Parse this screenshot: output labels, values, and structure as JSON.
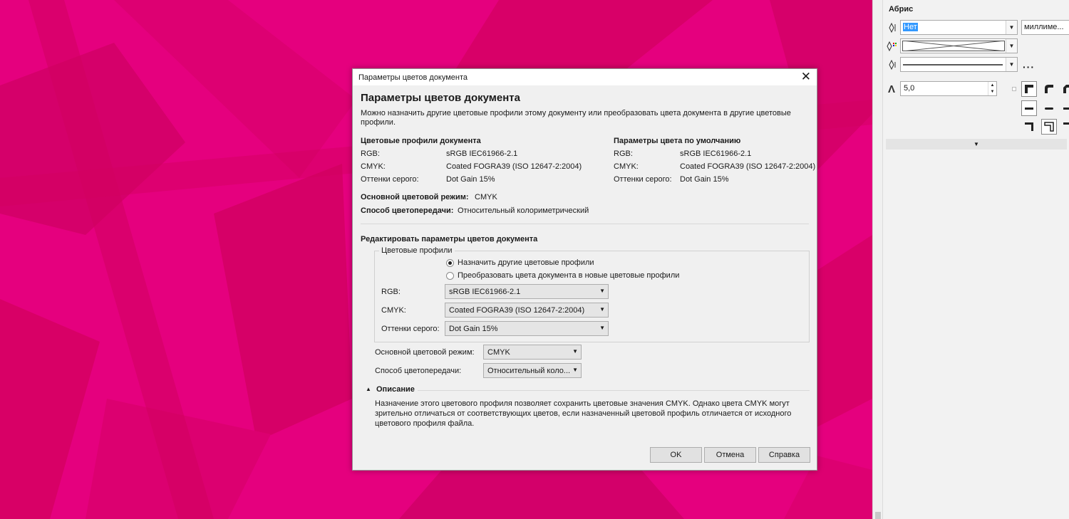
{
  "docker": {
    "title": "Абрис",
    "outline_width_value": "Нет",
    "units_value": "миллиме...",
    "miter_limit_value": "5,0",
    "expand_icon": "chevron-down-icon"
  },
  "dialog": {
    "window_title": "Параметры цветов документа",
    "heading": "Параметры цветов документа",
    "intro": "Можно назначить другие цветовые профили этому документу или преобразовать цвета документа в другие цветовые",
    "intro_cont": "профили.",
    "doc_profiles": {
      "heading": "Цветовые профили документа",
      "rgb_label": "RGB:",
      "rgb_value": "sRGB IEC61966-2.1",
      "cmyk_label": "CMYK:",
      "cmyk_value": "Coated FOGRA39 (ISO 12647-2:2004)",
      "gray_label": "Оттенки серого:",
      "gray_value": "Dot Gain 15%"
    },
    "default_settings": {
      "heading": "Параметры цвета по умолчанию",
      "rgb_label": "RGB:",
      "rgb_value": "sRGB IEC61966-2.1",
      "cmyk_label": "CMYK:",
      "cmyk_value": "Coated FOGRA39 (ISO 12647-2:2004)",
      "gray_label": "Оттенки серого:",
      "gray_value": "Dot Gain 15%"
    },
    "primary_mode_label": "Основной цветовой режим:",
    "primary_mode_value": "CMYK",
    "rendering_label": "Способ цветопередачи:",
    "rendering_value": "Относительный колориметрический",
    "edit": {
      "heading": "Редактировать параметры цветов документа",
      "group_label": "Цветовые профили",
      "radio_assign": "Назначить другие цветовые профили",
      "radio_convert": "Преобразовать цвета документа в новые цветовые профили",
      "rgb_label": "RGB:",
      "rgb_value": "sRGB IEC61966-2.1",
      "cmyk_label": "CMYK:",
      "cmyk_value": "Coated FOGRA39 (ISO 12647-2:2004)",
      "gray_label": "Оттенки серого:",
      "gray_value": "Dot Gain 15%",
      "mode_label": "Основной цветовой режим:",
      "mode_value": "CMYK",
      "rendering_label": "Способ цветопередачи:",
      "rendering_value": "Относительный коло..."
    },
    "description": {
      "heading": "Описание",
      "line1": "Назначение этого цветового профиля позволяет сохранить цветовые значения CMYK. Однако цвета CMYK могут",
      "line2": "зрительно отличаться от соответствующих цветов, если назначенный цветовой профиль отличается от исходного",
      "line3": "цветового профиля файла."
    },
    "buttons": {
      "ok": "OK",
      "cancel": "Отмена",
      "help": "Справка"
    }
  },
  "colors": {
    "canvas": "#e5007e",
    "canvas_dark": "#d70068",
    "dialog_bg": "#f0f0f0"
  }
}
